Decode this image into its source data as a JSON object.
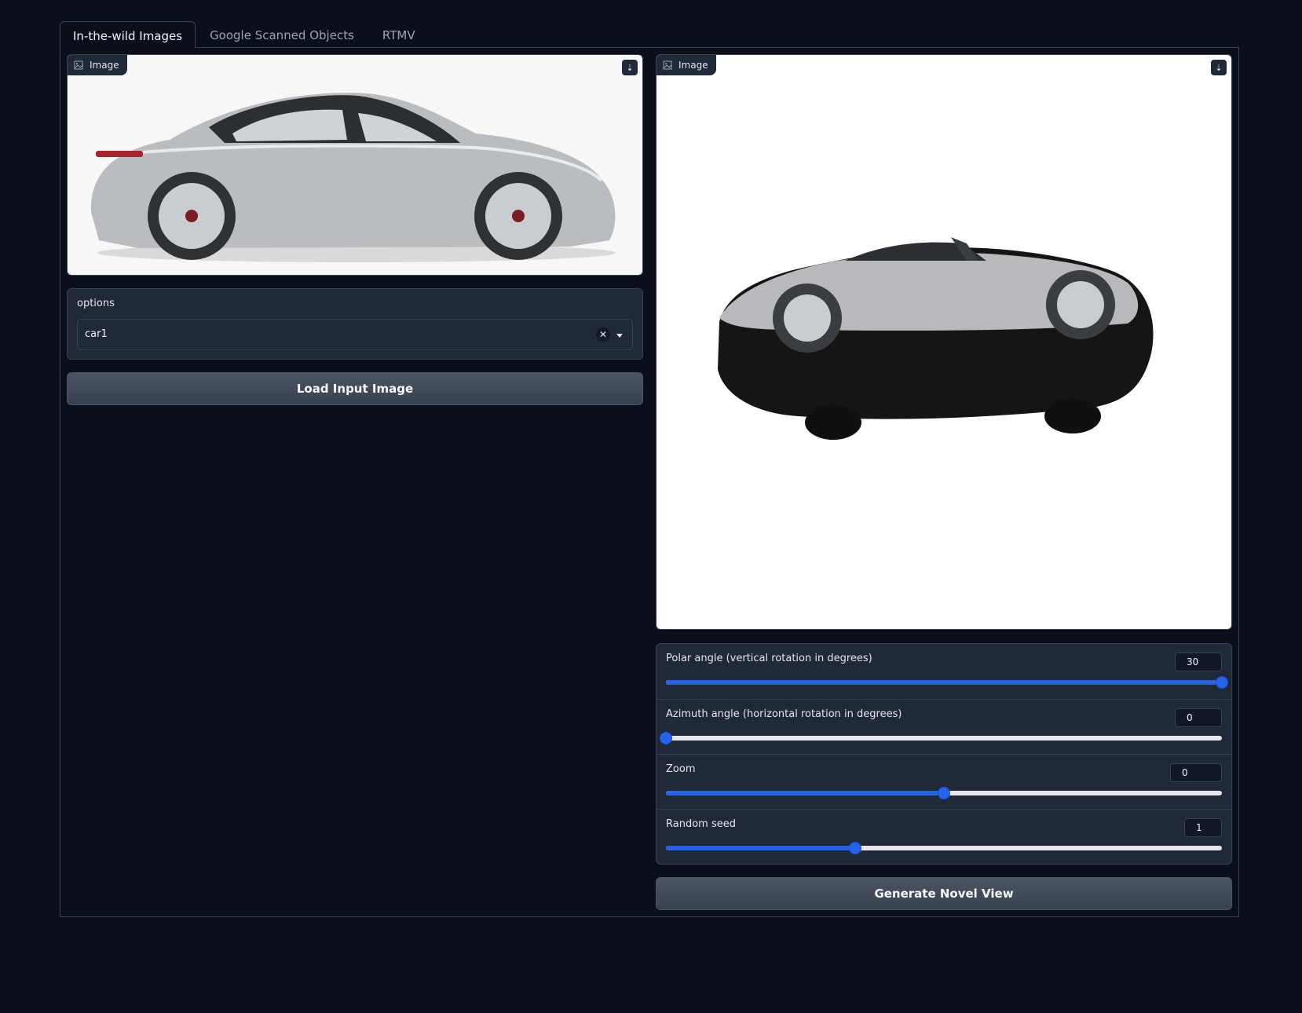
{
  "tabs": [
    {
      "label": "In-the-wild Images",
      "active": true
    },
    {
      "label": "Google Scanned Objects",
      "active": false
    },
    {
      "label": "RTMV",
      "active": false
    }
  ],
  "input_image": {
    "label": "Image",
    "icon": "image-icon",
    "download_icon": "download-icon"
  },
  "output_image": {
    "label": "Image",
    "icon": "image-icon",
    "download_icon": "download-icon"
  },
  "options": {
    "label": "options",
    "selected": "car1",
    "clear_icon": "close-icon",
    "caret_icon": "chevron-down-icon"
  },
  "load_button": {
    "label": "Load Input Image"
  },
  "sliders": [
    {
      "label": "Polar angle (vertical rotation in degrees)",
      "value": "30",
      "fraction": 1.0
    },
    {
      "label": "Azimuth angle (horizontal rotation in degrees)",
      "value": "0",
      "fraction": 0.0
    },
    {
      "label": "Zoom",
      "value": "0",
      "fraction": 0.5
    },
    {
      "label": "Random seed",
      "value": "1",
      "fraction": 0.34
    }
  ],
  "generate_button": {
    "label": "Generate Novel View"
  },
  "colors": {
    "background": "#0b0f19",
    "panel": "#1f2937",
    "border": "#374151",
    "accent": "#2563eb",
    "button": "#4b5563"
  }
}
